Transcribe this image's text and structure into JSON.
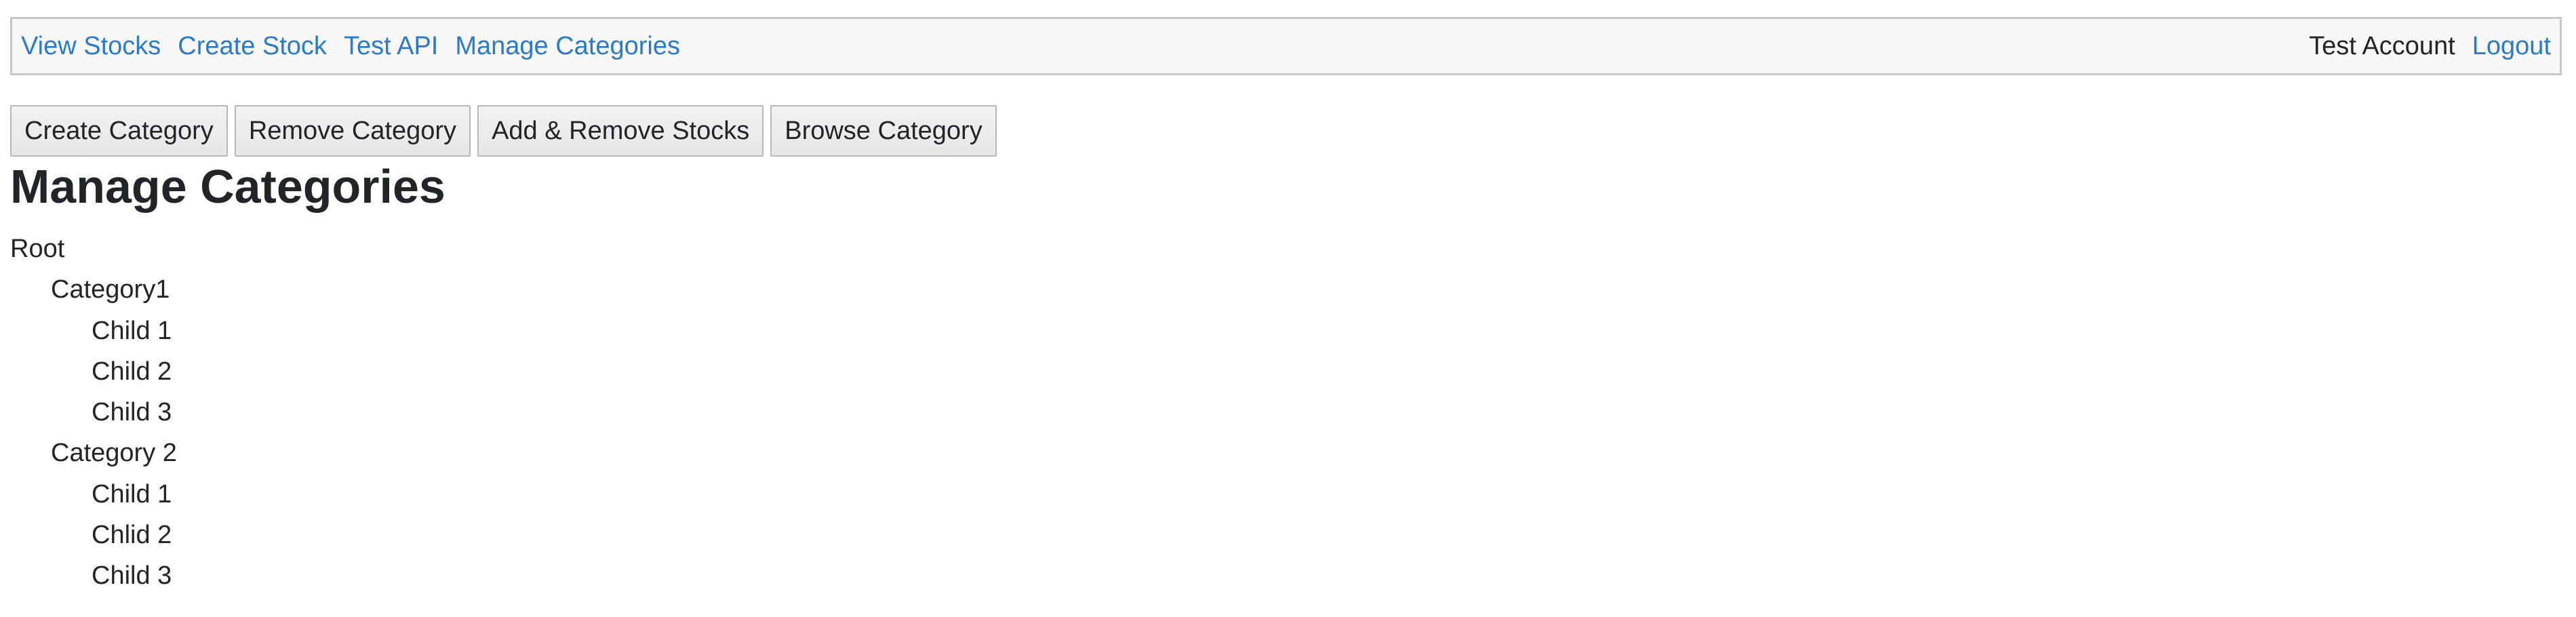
{
  "navbar": {
    "links": [
      "View Stocks",
      "Create Stock",
      "Test API",
      "Manage Categories"
    ],
    "account_name": "Test Account",
    "logout_label": "Logout"
  },
  "toolbar": {
    "create_category_label": "Create Category",
    "remove_category_label": "Remove Category",
    "add_remove_stocks_label": "Add & Remove Stocks",
    "browse_category_label": "Browse Category"
  },
  "main": {
    "title": "Manage Categories",
    "tree": [
      {
        "label": "Root",
        "level": 0
      },
      {
        "label": "Category1",
        "level": 1
      },
      {
        "label": "Child 1",
        "level": 2
      },
      {
        "label": "Child 2",
        "level": 2
      },
      {
        "label": "Child 3",
        "level": 2
      },
      {
        "label": "Category 2",
        "level": 1
      },
      {
        "label": "Child 1",
        "level": 2
      },
      {
        "label": "Chlid 2",
        "level": 2
      },
      {
        "label": "Child 3",
        "level": 2
      }
    ]
  }
}
